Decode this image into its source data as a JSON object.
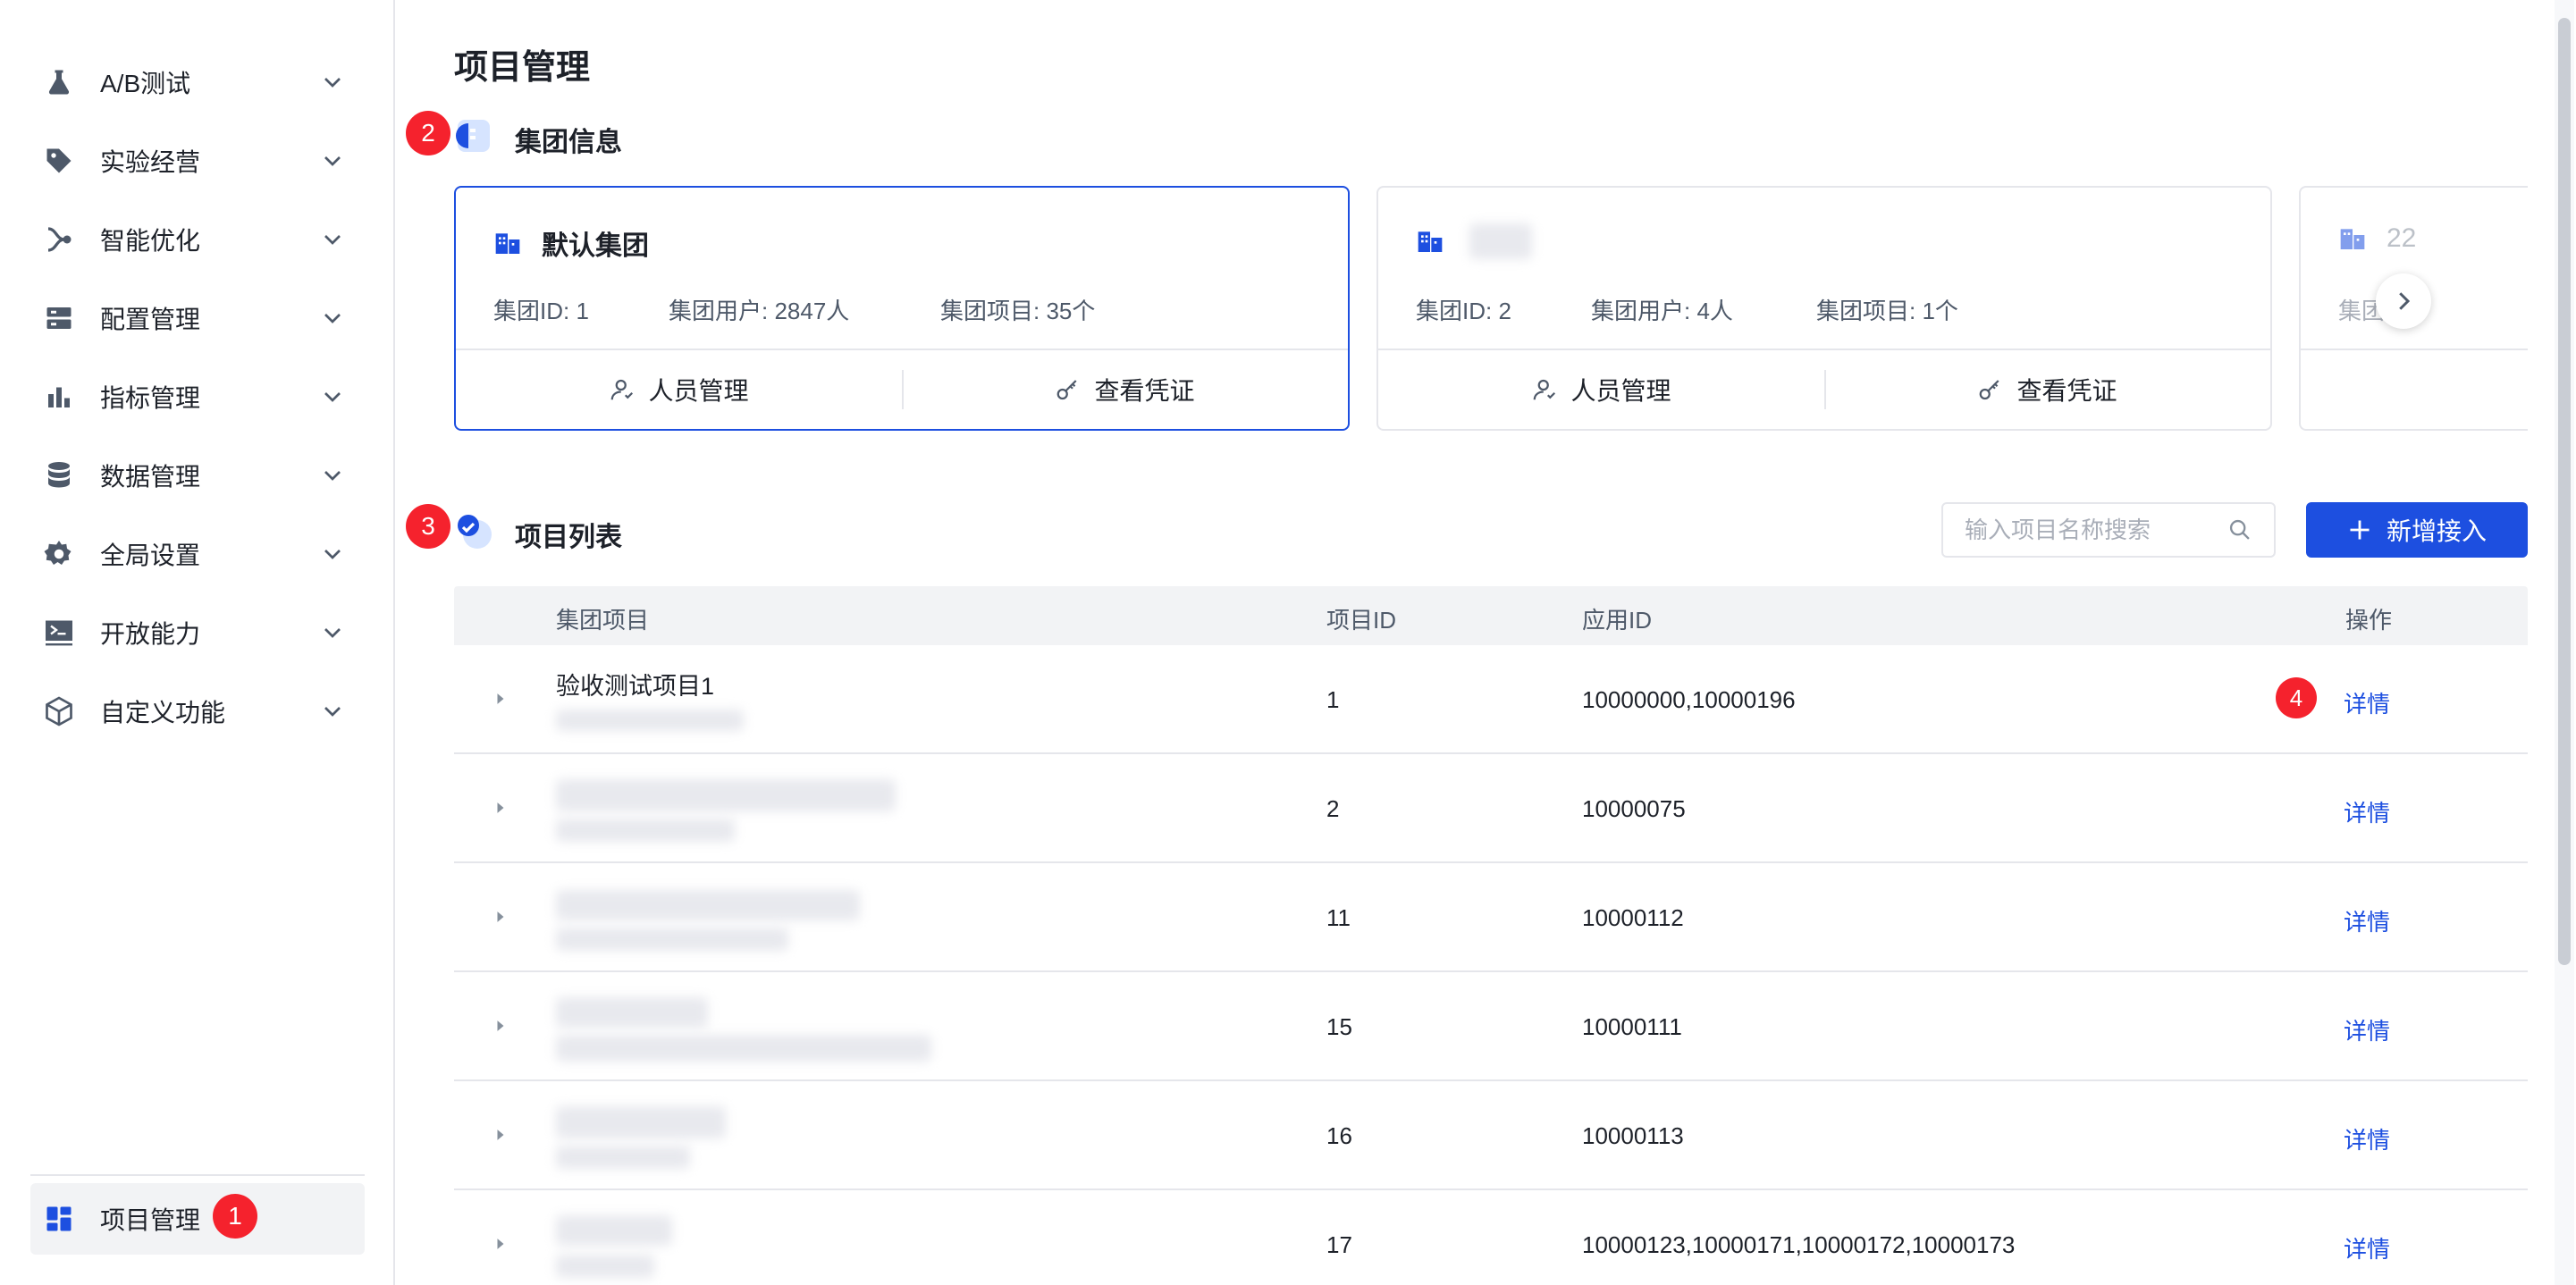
{
  "sidebar": {
    "items": [
      {
        "label": "A/B测试",
        "icon": "flask-icon"
      },
      {
        "label": "实验经营",
        "icon": "tag-icon"
      },
      {
        "label": "智能优化",
        "icon": "branch-icon"
      },
      {
        "label": "配置管理",
        "icon": "server-icon"
      },
      {
        "label": "指标管理",
        "icon": "bar-chart-icon"
      },
      {
        "label": "数据管理",
        "icon": "database-icon"
      },
      {
        "label": "全局设置",
        "icon": "gear-icon"
      },
      {
        "label": "开放能力",
        "icon": "terminal-icon"
      },
      {
        "label": "自定义功能",
        "icon": "cube-icon"
      }
    ],
    "active": {
      "label": "项目管理",
      "icon": "dashboard-icon"
    }
  },
  "badges": {
    "b1": "1",
    "b2": "2",
    "b3": "3",
    "b4": "4"
  },
  "page": {
    "title": "项目管理"
  },
  "group_section": {
    "title": "集团信息"
  },
  "cards": [
    {
      "name": "默认集团",
      "id_text": "集团ID: 1",
      "users_text": "集团用户: 2847人",
      "projects_text": "集团项目: 35个",
      "action_people": "人员管理",
      "action_credentials": "查看凭证"
    },
    {
      "name": "",
      "id_text": "集团ID: 2",
      "users_text": "集团用户: 4人",
      "projects_text": "集团项目: 1个",
      "action_people": "人员管理",
      "action_credentials": "查看凭证"
    },
    {
      "name": "22",
      "id_text": "集团"
    }
  ],
  "project_section": {
    "title": "项目列表"
  },
  "search": {
    "placeholder": "输入项目名称搜索",
    "value": ""
  },
  "add_button": {
    "label": "新增接入"
  },
  "table": {
    "headers": {
      "project": "集团项目",
      "project_id": "项目ID",
      "app_id": "应用ID",
      "action": "操作"
    },
    "rows": [
      {
        "name": "验收测试项目1",
        "project_id": "1",
        "app_id": "10000000,10000196",
        "action": "详情"
      },
      {
        "name": "",
        "project_id": "2",
        "app_id": "10000075",
        "action": "详情"
      },
      {
        "name": "",
        "project_id": "11",
        "app_id": "10000112",
        "action": "详情"
      },
      {
        "name": "",
        "project_id": "15",
        "app_id": "10000111",
        "action": "详情"
      },
      {
        "name": "",
        "project_id": "16",
        "app_id": "10000113",
        "action": "详情"
      },
      {
        "name": "",
        "project_id": "17",
        "app_id": "10000123,10000171,10000172,10000173",
        "action": "详情"
      }
    ]
  },
  "colors": {
    "accent": "#1d4fe0",
    "badge": "#f5222d",
    "border": "#e5e6eb",
    "header_bg": "#f2f3f5"
  }
}
